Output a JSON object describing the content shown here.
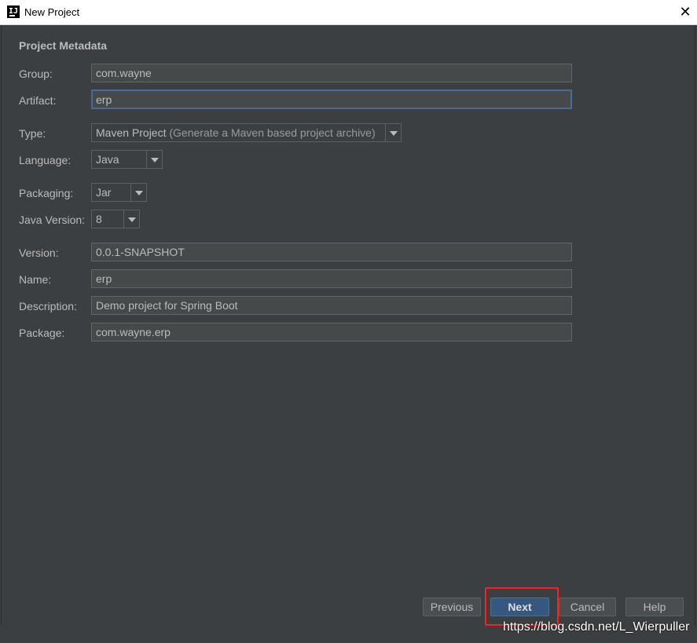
{
  "window": {
    "title": "New Project",
    "app_icon_text": "IJ",
    "close_glyph": "✕"
  },
  "form": {
    "section_title": "Project Metadata",
    "group": {
      "label": "Group:",
      "value": "com.wayne"
    },
    "artifact": {
      "label": "Artifact:",
      "value": "erp"
    },
    "type": {
      "label": "Type:",
      "value": "Maven Project",
      "hint": "(Generate a Maven based project archive)"
    },
    "language": {
      "label": "Language:",
      "value": "Java"
    },
    "packaging": {
      "label": "Packaging:",
      "value": "Jar"
    },
    "java_version": {
      "label": "Java Version:",
      "value": "8"
    },
    "version": {
      "label": "Version:",
      "value": "0.0.1-SNAPSHOT"
    },
    "name": {
      "label": "Name:",
      "value": "erp"
    },
    "description": {
      "label": "Description:",
      "value": "Demo project for Spring Boot"
    },
    "package": {
      "label": "Package:",
      "value": "com.wayne.erp"
    }
  },
  "buttons": {
    "previous": "Previous",
    "next": "Next",
    "cancel": "Cancel",
    "help": "Help"
  },
  "watermark": "https://blog.csdn.net/L_Wierpuller",
  "colors": {
    "background": "#3c3f41",
    "primary_button": "#365880",
    "highlight": "#ff1f1f",
    "focus_border": "#466d94"
  }
}
